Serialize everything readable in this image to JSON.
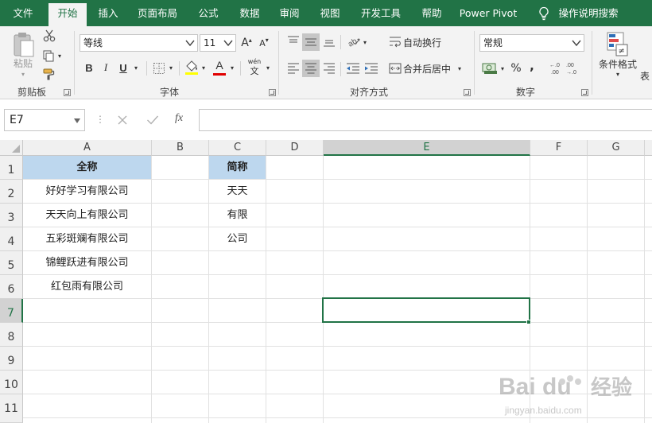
{
  "menu": {
    "tabs": [
      "文件",
      "开始",
      "插入",
      "页面布局",
      "公式",
      "数据",
      "审阅",
      "视图",
      "开发工具",
      "帮助",
      "Power Pivot"
    ],
    "active": "开始",
    "search_label": "操作说明搜索"
  },
  "ribbon": {
    "clipboard": {
      "label": "剪贴板",
      "paste": "粘贴"
    },
    "font": {
      "label": "字体",
      "font_name": "等线",
      "font_size": "11",
      "grow": "A",
      "shrink": "A",
      "bold": "B",
      "italic": "I",
      "underline": "U",
      "font_color_letter": "A",
      "phonetic_top": "wén",
      "phonetic_bottom": "文"
    },
    "alignment": {
      "label": "对齐方式",
      "wrap_text": "自动换行",
      "merge_center": "合并后居中"
    },
    "number": {
      "label": "数字",
      "format": "常规",
      "percent": "%",
      "comma": ","
    },
    "styles": {
      "conditional": "条件格式",
      "table_partial": "表"
    }
  },
  "formula_bar": {
    "name_box": "E7",
    "fx": "fx",
    "formula": ""
  },
  "grid": {
    "columns": [
      "A",
      "B",
      "C",
      "D",
      "E",
      "F",
      "G"
    ],
    "rows": [
      "1",
      "2",
      "3",
      "4",
      "5",
      "6",
      "7",
      "8",
      "9",
      "10",
      "11"
    ],
    "selected_cell": "E7",
    "cells": {
      "A1": "全称",
      "A2": "好好学习有限公司",
      "A3": "天天向上有限公司",
      "A4": "五彩斑斓有限公司",
      "A5": "锦鲤跃进有限公司",
      "A6": "红包雨有限公司",
      "C1": "简称",
      "C2": "天天",
      "C3": "有限",
      "C4": "公司"
    }
  },
  "watermark": {
    "brand": "Bai du",
    "sub": "经验",
    "url": "jingyan.baidu.com"
  },
  "colors": {
    "accent": "#217346",
    "header_fill": "#bdd7ee"
  }
}
